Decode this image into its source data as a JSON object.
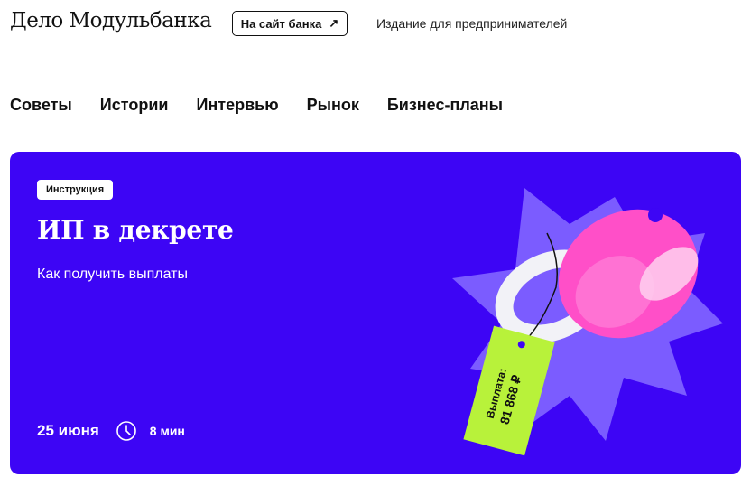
{
  "header": {
    "logo": "Дело Модульбанка",
    "bank_button": "На сайт банка",
    "tagline": "Издание для предпринимателей"
  },
  "nav": {
    "items": [
      {
        "label": "Советы"
      },
      {
        "label": "Истории"
      },
      {
        "label": "Интервью"
      },
      {
        "label": "Рынок"
      },
      {
        "label": "Бизнес-планы"
      }
    ]
  },
  "hero": {
    "badge": "Инструкция",
    "title": "ИП в декрете",
    "subtitle": "Как получить выплаты",
    "date": "25 июня",
    "read_time": "8 мин",
    "tag_line1": "Выплата:",
    "tag_line2": "81 868 ₽",
    "colors": {
      "background": "#3d05f5",
      "burst": "#7b5cff",
      "pacifier": "#ff4fc8",
      "tag": "#b8f23a"
    }
  }
}
